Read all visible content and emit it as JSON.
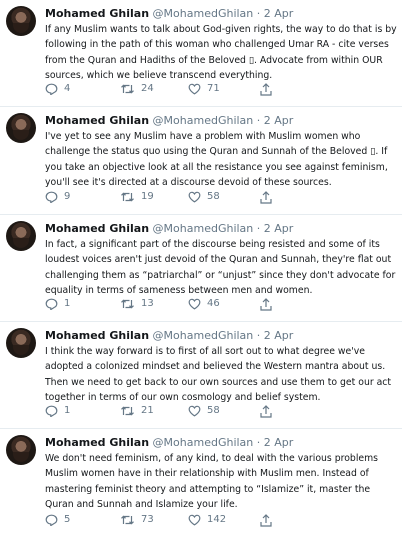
{
  "tweets": [
    {
      "name": "Mohamed Ghilan",
      "handle": "@MohamedGhilan",
      "dot": "·",
      "date": "2 Apr",
      "text": "If any Muslim wants to talk about God-given rights, the way to do that is by following in the path of this woman who challenged Umar RA - cite verses from the Quran and Hadiths of the Beloved ▯. Advocate from within OUR sources, which we believe transcend everything.",
      "replies": "4",
      "retweets": "24",
      "likes": "71"
    },
    {
      "name": "Mohamed Ghilan",
      "handle": "@MohamedGhilan",
      "dot": "·",
      "date": "2 Apr",
      "text": "I've yet to see any Muslim have a problem with Muslim women who challenge the status quo using the Quran and Sunnah of the Beloved ▯. If you take an objective look at all the resistance you see against feminism, you'll see it's directed at a discourse devoid of these sources.",
      "replies": "9",
      "retweets": "19",
      "likes": "58"
    },
    {
      "name": "Mohamed Ghilan",
      "handle": "@MohamedGhilan",
      "dot": "·",
      "date": "2 Apr",
      "text": "In fact, a significant part of the discourse being resisted and some of its loudest voices aren't just devoid of the Quran and Sunnah, they're flat out challenging them as “patriarchal” or “unjust” since they don't advocate for equality in terms of sameness between men and women.",
      "replies": "1",
      "retweets": "13",
      "likes": "46"
    },
    {
      "name": "Mohamed Ghilan",
      "handle": "@MohamedGhilan",
      "dot": "·",
      "date": "2 Apr",
      "text": "I think the way forward is to first of all sort out to what degree we've adopted a colonized mindset and believed the Western mantra about us. Then we need to get back to our own sources and use them to get our act together in terms of our own cosmology and belief system.",
      "replies": "1",
      "retweets": "21",
      "likes": "58"
    },
    {
      "name": "Mohamed Ghilan",
      "handle": "@MohamedGhilan",
      "dot": "·",
      "date": "2 Apr",
      "text": "We don't need feminism, of any kind, to deal with the various problems Muslim women have in their relationship with Muslim men. Instead of mastering feminist theory and attempting to “Islamize” it, master the Quran and Sunnah and Islamize your life.",
      "replies": "5",
      "retweets": "73",
      "likes": "142"
    }
  ],
  "icons": {
    "reply": "reply-icon",
    "retweet": "retweet-icon",
    "like": "heart-icon",
    "share": "share-icon"
  },
  "colors": {
    "text": "#14171a",
    "muted": "#657786",
    "divider": "#e6ecf0"
  }
}
